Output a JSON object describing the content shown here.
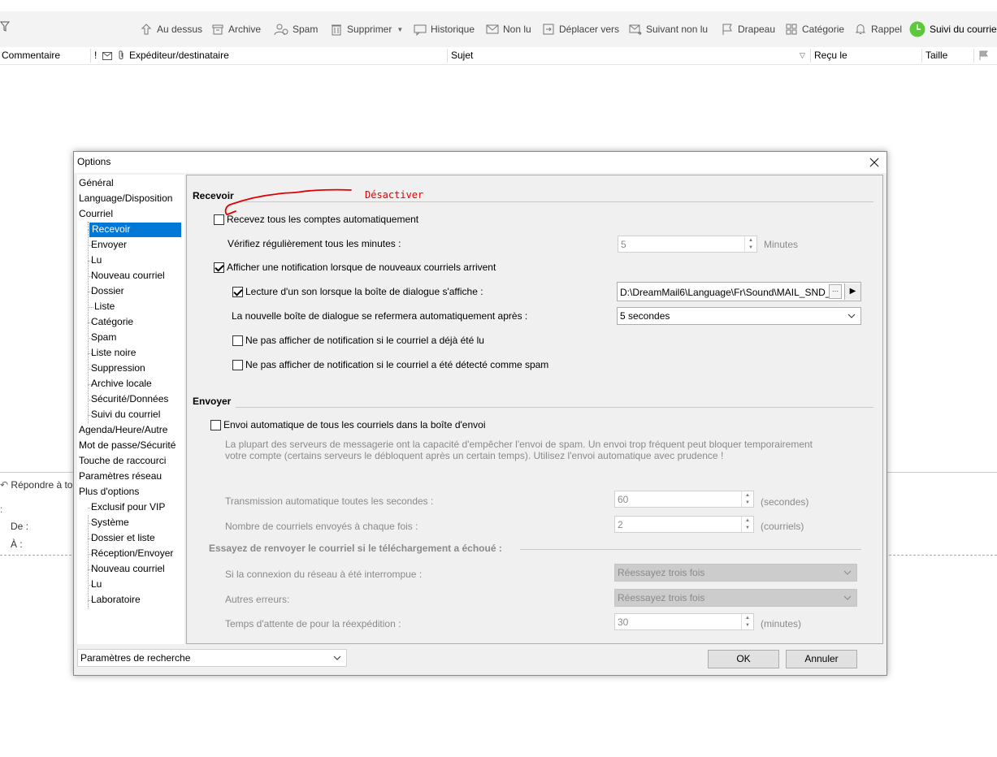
{
  "toolbar": {
    "items": [
      "Au dessus",
      "Archive",
      "Spam",
      "Supprimer",
      "Historique",
      "Non lu",
      "Déplacer vers",
      "Suivant non lu",
      "Drapeau",
      "Catégorie",
      "Rappel",
      "Suivi du courriel"
    ]
  },
  "list_header": {
    "comment": "Commentaire",
    "flag_mark": "!",
    "sender": "Expéditeur/destinataire",
    "subject": "Sujet",
    "received": "Reçu le",
    "size": "Taille"
  },
  "preview": {
    "reply": "Répondre à to",
    "from": "De :",
    "to": "À :"
  },
  "dialog": {
    "title": "Options",
    "nav": [
      "Général",
      "Language/Disposition",
      "Courriel",
      "Recevoir",
      "Envoyer",
      "Lu",
      "Nouveau courriel",
      "Dossier",
      "Liste",
      "Catégorie",
      "Spam",
      "Liste noire",
      "Suppression",
      "Archive locale",
      "Sécurité/Données",
      "Suivi du courriel",
      "Agenda/Heure/Autre",
      "Mot de passe/Sécurité",
      "Touche de raccourci",
      "Paramètres réseau",
      "Plus d'options",
      "Exclusif pour VIP",
      "Système",
      "Dossier et liste",
      "Réception/Envoyer",
      "Nouveau courriel",
      "Lu",
      "Laboratoire"
    ],
    "search_combo": "Paramètres de recherche",
    "ok": "OK",
    "cancel": "Annuler",
    "receive": {
      "title": "Recevoir",
      "annotation": "Désactiver",
      "auto_all": "Recevez tous les comptes automatiquement",
      "check_every": "Vérifiez régulièrement tous les minutes :",
      "check_value": "5",
      "check_unit": "Minutes",
      "notify": "Afficher une notification lorsque de nouveaux courriels arrivent",
      "sound": "Lecture d'un son lorsque la boîte de dialogue s'affiche :",
      "sound_path": "D:\\DreamMail6\\Language\\Fr\\Sound\\MAIL_SND_",
      "browse": "···",
      "play": "▶",
      "close_after": "La nouvelle boîte de dialogue se refermera automatiquement après :",
      "close_value": "5 secondes",
      "no_notify_read": "Ne pas afficher de notification si le courriel a déjà été lu",
      "no_notify_spam": "Ne pas afficher de notification si le courriel a été détecté comme spam"
    },
    "send": {
      "title": "Envoyer",
      "auto_send": "Envoi automatique de tous les  courriels dans la boîte d'envoi",
      "note_line1": "La plupart des serveurs de messagerie ont la capacité d'empêcher l'envoi de spam. Un envoi trop fréquent peut bloquer temporairement",
      "note_line2": "votre compte (certains serveurs le débloquent après un certain temps). Utilisez l'envoi automatique avec prudence !",
      "interval_label": "Transmission automatique toutes les secondes :",
      "interval_value": "60",
      "interval_unit": "(secondes)",
      "count_label": "Nombre de courriels envoyés à chaque fois :",
      "count_value": "2",
      "count_unit": "(courriels)",
      "retry_title": "Essayez de renvoyer le courriel si le téléchargement a échoué :",
      "net_label": "Si la connexion du réseau à été interrompue :",
      "net_value": "Réessayez trois fois",
      "other_label": "Autres erreurs:",
      "other_value": "Réessayez trois fois",
      "wait_label": "Temps d'attente de pour la réexpédition :",
      "wait_value": "30",
      "wait_unit": "(minutes)"
    }
  },
  "colors": {
    "selection": "#0078d7",
    "annotation": "#e00000",
    "accent_green": "#5cc93b"
  }
}
